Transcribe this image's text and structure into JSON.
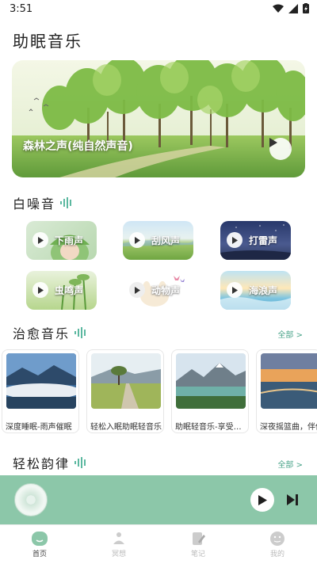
{
  "status": {
    "time": "3:51"
  },
  "header": {
    "title": "助眠音乐"
  },
  "banner": {
    "title": "森林之声(纯自然声音)"
  },
  "white_noise": {
    "title": "白噪音",
    "items": [
      {
        "label": "下雨声"
      },
      {
        "label": "刮风声"
      },
      {
        "label": "打雷声"
      },
      {
        "label": "虫鸣声"
      },
      {
        "label": "动物声"
      },
      {
        "label": "海浪声"
      }
    ]
  },
  "healing": {
    "title": "治愈音乐",
    "more": "全部 >",
    "cards": [
      {
        "text": "深度睡眠-雨声催眠"
      },
      {
        "text": "轻松入眠助眠轻音乐"
      },
      {
        "text": "助眠轻音乐-享受宁静"
      },
      {
        "text": "深夜摇篮曲，伴你入眠"
      }
    ]
  },
  "rhythm": {
    "title": "轻松韵律",
    "more": "全部 >"
  },
  "nav": {
    "items": [
      {
        "label": "首页"
      },
      {
        "label": "冥想"
      },
      {
        "label": "笔记"
      },
      {
        "label": "我的"
      }
    ]
  }
}
